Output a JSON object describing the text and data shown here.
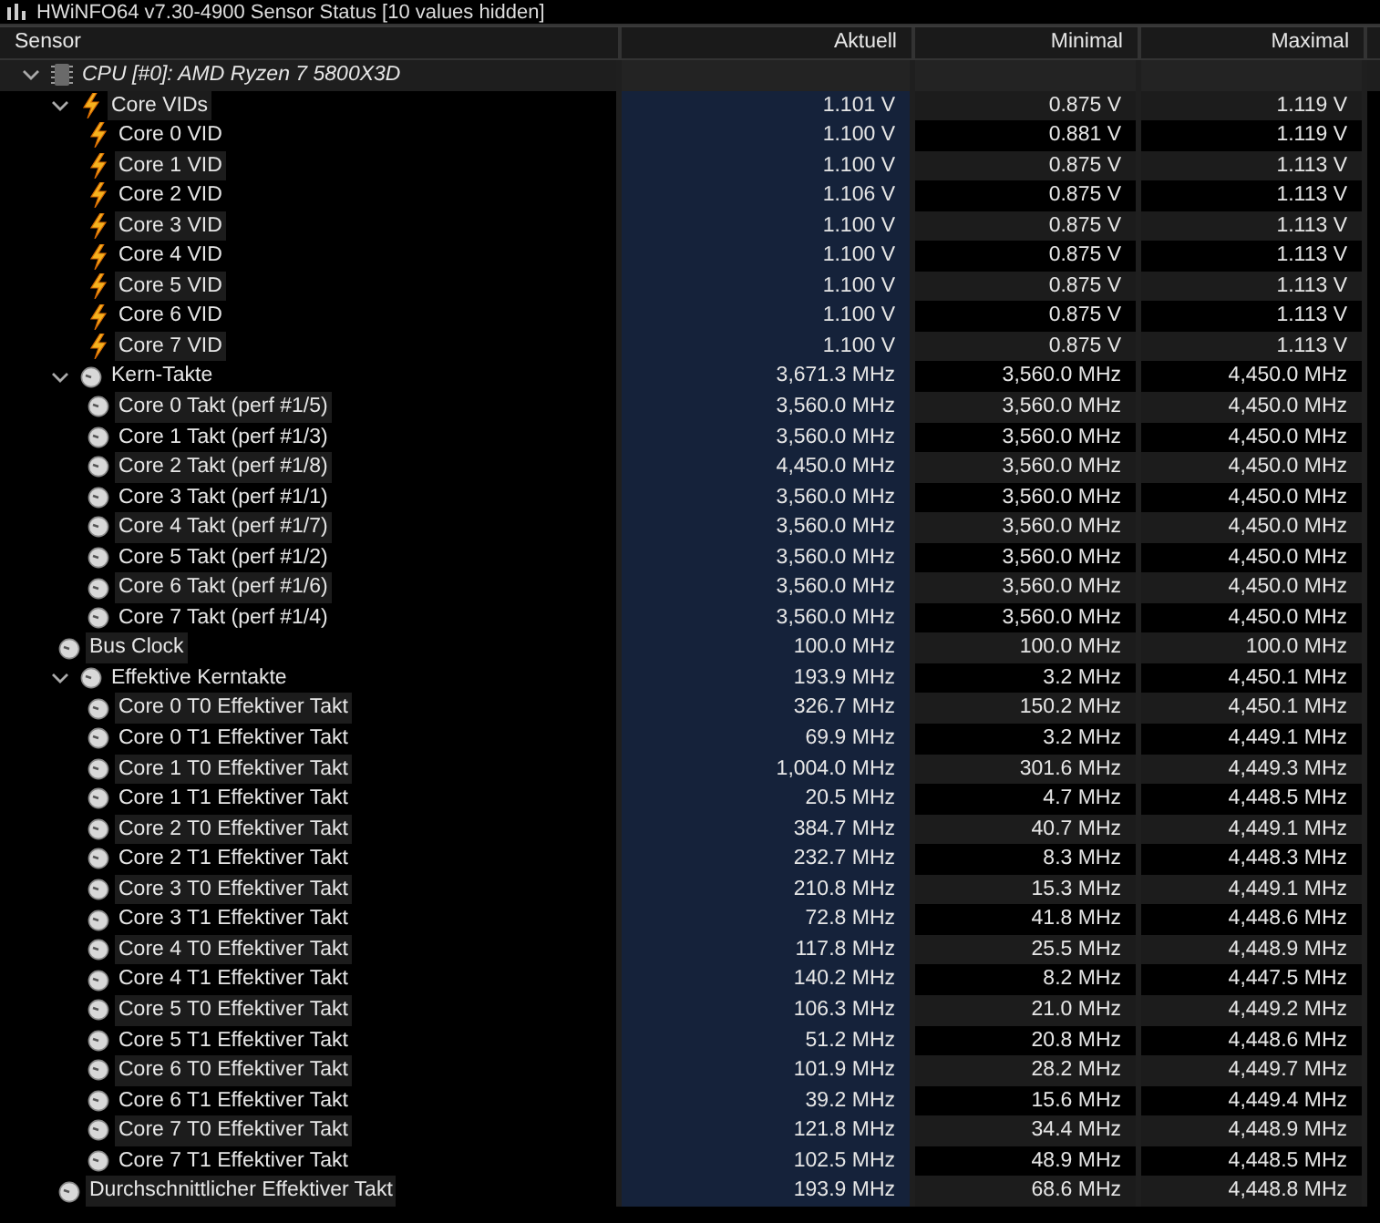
{
  "window": {
    "title": "HWiNFO64 v7.30-4900 Sensor Status [10 values hidden]"
  },
  "table": {
    "columns": [
      "Sensor",
      "Aktuell",
      "Minimal",
      "Maximal"
    ],
    "rows": [
      {
        "kind": "device",
        "name": "CPU [#0]: AMD Ryzen 7 5800X3D",
        "expanded": true,
        "children": [
          {
            "kind": "voltage-group",
            "name": "Core VIDs",
            "expanded": true,
            "values": [
              "1.101 V",
              "0.875 V",
              "1.119 V"
            ],
            "children": [
              {
                "kind": "voltage",
                "name": "Core 0 VID",
                "values": [
                  "1.100 V",
                  "0.881 V",
                  "1.119 V"
                ]
              },
              {
                "kind": "voltage",
                "name": "Core 1 VID",
                "values": [
                  "1.100 V",
                  "0.875 V",
                  "1.113 V"
                ]
              },
              {
                "kind": "voltage",
                "name": "Core 2 VID",
                "values": [
                  "1.106 V",
                  "0.875 V",
                  "1.113 V"
                ]
              },
              {
                "kind": "voltage",
                "name": "Core 3 VID",
                "values": [
                  "1.100 V",
                  "0.875 V",
                  "1.113 V"
                ]
              },
              {
                "kind": "voltage",
                "name": "Core 4 VID",
                "values": [
                  "1.100 V",
                  "0.875 V",
                  "1.113 V"
                ]
              },
              {
                "kind": "voltage",
                "name": "Core 5 VID",
                "values": [
                  "1.100 V",
                  "0.875 V",
                  "1.113 V"
                ]
              },
              {
                "kind": "voltage",
                "name": "Core 6 VID",
                "values": [
                  "1.100 V",
                  "0.875 V",
                  "1.113 V"
                ]
              },
              {
                "kind": "voltage",
                "name": "Core 7 VID",
                "values": [
                  "1.100 V",
                  "0.875 V",
                  "1.113 V"
                ]
              }
            ]
          },
          {
            "kind": "clock-group",
            "name": "Kern-Takte",
            "expanded": true,
            "values": [
              "3,671.3 MHz",
              "3,560.0 MHz",
              "4,450.0 MHz"
            ],
            "children": [
              {
                "kind": "clock",
                "name": "Core 0 Takt (perf #1/5)",
                "values": [
                  "3,560.0 MHz",
                  "3,560.0 MHz",
                  "4,450.0 MHz"
                ]
              },
              {
                "kind": "clock",
                "name": "Core 1 Takt (perf #1/3)",
                "values": [
                  "3,560.0 MHz",
                  "3,560.0 MHz",
                  "4,450.0 MHz"
                ]
              },
              {
                "kind": "clock",
                "name": "Core 2 Takt (perf #1/8)",
                "values": [
                  "4,450.0 MHz",
                  "3,560.0 MHz",
                  "4,450.0 MHz"
                ]
              },
              {
                "kind": "clock",
                "name": "Core 3 Takt (perf #1/1)",
                "values": [
                  "3,560.0 MHz",
                  "3,560.0 MHz",
                  "4,450.0 MHz"
                ]
              },
              {
                "kind": "clock",
                "name": "Core 4 Takt (perf #1/7)",
                "values": [
                  "3,560.0 MHz",
                  "3,560.0 MHz",
                  "4,450.0 MHz"
                ]
              },
              {
                "kind": "clock",
                "name": "Core 5 Takt (perf #1/2)",
                "values": [
                  "3,560.0 MHz",
                  "3,560.0 MHz",
                  "4,450.0 MHz"
                ]
              },
              {
                "kind": "clock",
                "name": "Core 6 Takt (perf #1/6)",
                "values": [
                  "3,560.0 MHz",
                  "3,560.0 MHz",
                  "4,450.0 MHz"
                ]
              },
              {
                "kind": "clock",
                "name": "Core 7 Takt (perf #1/4)",
                "values": [
                  "3,560.0 MHz",
                  "3,560.0 MHz",
                  "4,450.0 MHz"
                ]
              }
            ]
          },
          {
            "kind": "clock",
            "name": "Bus Clock",
            "values": [
              "100.0 MHz",
              "100.0 MHz",
              "100.0 MHz"
            ]
          },
          {
            "kind": "clock-group",
            "name": "Effektive Kerntakte",
            "expanded": true,
            "values": [
              "193.9 MHz",
              "3.2 MHz",
              "4,450.1 MHz"
            ],
            "children": [
              {
                "kind": "clock",
                "name": "Core 0 T0 Effektiver Takt",
                "values": [
                  "326.7 MHz",
                  "150.2 MHz",
                  "4,450.1 MHz"
                ]
              },
              {
                "kind": "clock",
                "name": "Core 0 T1 Effektiver Takt",
                "values": [
                  "69.9 MHz",
                  "3.2 MHz",
                  "4,449.1 MHz"
                ]
              },
              {
                "kind": "clock",
                "name": "Core 1 T0 Effektiver Takt",
                "values": [
                  "1,004.0 MHz",
                  "301.6 MHz",
                  "4,449.3 MHz"
                ]
              },
              {
                "kind": "clock",
                "name": "Core 1 T1 Effektiver Takt",
                "values": [
                  "20.5 MHz",
                  "4.7 MHz",
                  "4,448.5 MHz"
                ]
              },
              {
                "kind": "clock",
                "name": "Core 2 T0 Effektiver Takt",
                "values": [
                  "384.7 MHz",
                  "40.7 MHz",
                  "4,449.1 MHz"
                ]
              },
              {
                "kind": "clock",
                "name": "Core 2 T1 Effektiver Takt",
                "values": [
                  "232.7 MHz",
                  "8.3 MHz",
                  "4,448.3 MHz"
                ]
              },
              {
                "kind": "clock",
                "name": "Core 3 T0 Effektiver Takt",
                "values": [
                  "210.8 MHz",
                  "15.3 MHz",
                  "4,449.1 MHz"
                ]
              },
              {
                "kind": "clock",
                "name": "Core 3 T1 Effektiver Takt",
                "values": [
                  "72.8 MHz",
                  "41.8 MHz",
                  "4,448.6 MHz"
                ]
              },
              {
                "kind": "clock",
                "name": "Core 4 T0 Effektiver Takt",
                "values": [
                  "117.8 MHz",
                  "25.5 MHz",
                  "4,448.9 MHz"
                ]
              },
              {
                "kind": "clock",
                "name": "Core 4 T1 Effektiver Takt",
                "values": [
                  "140.2 MHz",
                  "8.2 MHz",
                  "4,447.5 MHz"
                ]
              },
              {
                "kind": "clock",
                "name": "Core 5 T0 Effektiver Takt",
                "values": [
                  "106.3 MHz",
                  "21.0 MHz",
                  "4,449.2 MHz"
                ]
              },
              {
                "kind": "clock",
                "name": "Core 5 T1 Effektiver Takt",
                "values": [
                  "51.2 MHz",
                  "20.8 MHz",
                  "4,448.6 MHz"
                ]
              },
              {
                "kind": "clock",
                "name": "Core 6 T0 Effektiver Takt",
                "values": [
                  "101.9 MHz",
                  "28.2 MHz",
                  "4,449.7 MHz"
                ]
              },
              {
                "kind": "clock",
                "name": "Core 6 T1 Effektiver Takt",
                "values": [
                  "39.2 MHz",
                  "15.6 MHz",
                  "4,449.4 MHz"
                ]
              },
              {
                "kind": "clock",
                "name": "Core 7 T0 Effektiver Takt",
                "values": [
                  "121.8 MHz",
                  "34.4 MHz",
                  "4,448.9 MHz"
                ]
              },
              {
                "kind": "clock",
                "name": "Core 7 T1 Effektiver Takt",
                "values": [
                  "102.5 MHz",
                  "48.9 MHz",
                  "4,448.5 MHz"
                ]
              }
            ]
          },
          {
            "kind": "clock",
            "name": "Durchschnittlicher Effektiver Takt",
            "values": [
              "193.9 MHz",
              "68.6 MHz",
              "4,448.8 MHz"
            ]
          }
        ]
      }
    ]
  }
}
